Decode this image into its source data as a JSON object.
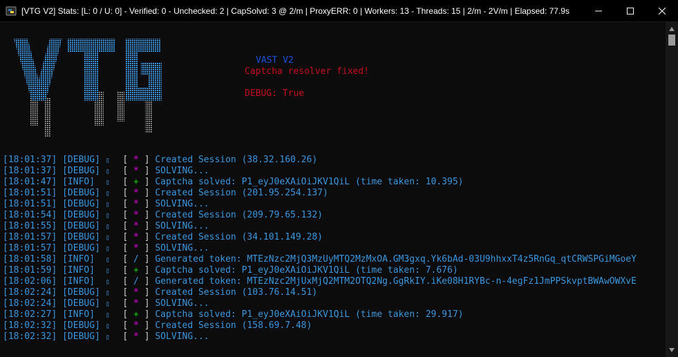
{
  "window": {
    "title": "[VTG V2] Stats: [L: 0 / U: 0] - Verified: 0 - Unchecked: 2 | CapSolvd: 3 @ 2/m | ProxyERR: 0 | Workers: 13 - Threads: 15 | 2/m - 2V/m | Elapsed: 77.9s",
    "icon": "python-icon",
    "controls": [
      "minimize",
      "maximize",
      "close"
    ]
  },
  "banner": {
    "logo_text": "VTG",
    "version": "VAST V2",
    "notice": "Captcha resolver fixed!",
    "debug": "DEBUG: True",
    "colors": {
      "logo": "#3a96dd",
      "version": "#1a4fd6",
      "notice": "#c50f1f"
    }
  },
  "log": [
    {
      "time": "[18:01:37]",
      "level": "[DEBUG]",
      "sym": "*",
      "msg": "Created Session (38.32.160.26)"
    },
    {
      "time": "[18:01:37]",
      "level": "[DEBUG]",
      "sym": "*",
      "msg": "SOLVING..."
    },
    {
      "time": "[18:01:47]",
      "level": "[INFO] ",
      "sym": "+",
      "msg": "Captcha solved: P1_eyJ0eXAiOiJKV1QiL (time taken: 10.395)"
    },
    {
      "time": "[18:01:51]",
      "level": "[DEBUG]",
      "sym": "*",
      "msg": "Created Session (201.95.254.137)"
    },
    {
      "time": "[18:01:51]",
      "level": "[DEBUG]",
      "sym": "*",
      "msg": "SOLVING..."
    },
    {
      "time": "[18:01:54]",
      "level": "[DEBUG]",
      "sym": "*",
      "msg": "Created Session (209.79.65.132)"
    },
    {
      "time": "[18:01:55]",
      "level": "[DEBUG]",
      "sym": "*",
      "msg": "SOLVING..."
    },
    {
      "time": "[18:01:57]",
      "level": "[DEBUG]",
      "sym": "*",
      "msg": "Created Session (34.101.149.28)"
    },
    {
      "time": "[18:01:57]",
      "level": "[DEBUG]",
      "sym": "*",
      "msg": "SOLVING..."
    },
    {
      "time": "[18:01:58]",
      "level": "[INFO] ",
      "sym": "/",
      "msg": "Generated token: MTEzNzc2MjQ3MzUyMTQ2MzMxOA.GM3gxq.Yk6bAd-03U9hhxxT4z5RnGq_qtCRWSPGiMGoeY"
    },
    {
      "time": "[18:01:59]",
      "level": "[INFO] ",
      "sym": "+",
      "msg": "Captcha solved: P1_eyJ0eXAiOiJKV1QiL (time taken: 7.676)"
    },
    {
      "time": "[18:02:06]",
      "level": "[INFO] ",
      "sym": "/",
      "msg": "Generated token: MTEzNzc2MjUxMjQ2MTM2OTQ2Ng.GgRkIY.iKe08H1RYBc-n-4egFz1JmPPSkvptBWAwOWXvE"
    },
    {
      "time": "[18:02:24]",
      "level": "[DEBUG]",
      "sym": "*",
      "msg": "Created Session (103.76.14.51)"
    },
    {
      "time": "[18:02:24]",
      "level": "[DEBUG]",
      "sym": "*",
      "msg": "SOLVING..."
    },
    {
      "time": "[18:02:27]",
      "level": "[INFO] ",
      "sym": "+",
      "msg": "Captcha solved: P1_eyJ0eXAiOiJKV1QiL (time taken: 29.917)"
    },
    {
      "time": "[18:02:32]",
      "level": "[DEBUG]",
      "sym": "*",
      "msg": "Created Session (158.69.7.48)"
    },
    {
      "time": "[18:02:32]",
      "level": "[DEBUG]",
      "sym": "*",
      "msg": "SOLVING..."
    }
  ]
}
